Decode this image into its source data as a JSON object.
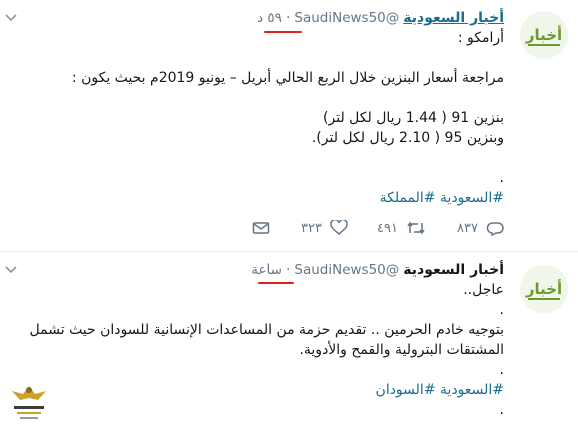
{
  "tweet1": {
    "author_name": "أخبار السعودية",
    "handle": "@SaudiNews50",
    "time": "٥٩ د",
    "lines": [
      "أرامكو :",
      "",
      "مراجعة أسعار البنزين خلال الربع الحالي أبريل – يونيو 2019م بحيث يكون :",
      "",
      "بنزين 91 ( 1.44 ريال لكل لتر)",
      "وبنزين 95 ( 2.10 ريال لكل لتر).",
      "",
      "."
    ],
    "hashtags": [
      "#السعودية",
      "#المملكة"
    ],
    "actions": {
      "reply_count": "٨٣٧",
      "retweet_count": "٤٩١",
      "like_count": "٣٢٣"
    }
  },
  "tweet2": {
    "author_name": "أخبار السعودية",
    "handle": "@SaudiNews50",
    "time": "ساعة",
    "lines": [
      "عاجل..",
      ".",
      "بتوجيه خادم الحرمين .. تقديم حزمة من المساعدات الإنسانية للسودان حيث تشمل",
      "المشتقات البترولية والقمح والأدوية.",
      "."
    ],
    "hashtags": [
      "#السعودية",
      "#السودان"
    ],
    "last_line": "."
  },
  "avatar_logo_text": "أخبار",
  "colors": {
    "link": "#1b6d8e",
    "muted": "#657786",
    "highlight": "#e02020",
    "logo_green": "#6c9a2e"
  }
}
